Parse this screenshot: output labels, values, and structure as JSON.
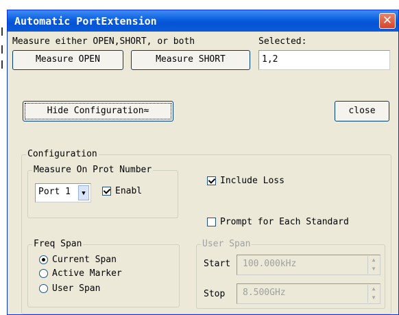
{
  "window": {
    "title": "Automatic PortExtension",
    "close_glyph": "✕"
  },
  "measure": {
    "instruction": "Measure either OPEN,SHORT, or both",
    "open_label": "Measure OPEN",
    "short_label": "Measure SHORT"
  },
  "selected": {
    "label": "Selected:",
    "value": "1,2"
  },
  "toggle_config_label": "Hide Configuration≈",
  "close_label": "close",
  "configuration": {
    "title": "Configuration",
    "port_group": {
      "title": "Measure On Prot Number",
      "port_value": "Port 1",
      "enable_label": "Enabl",
      "enable_checked": true
    },
    "include_loss": {
      "label": "Include Loss",
      "checked": true
    },
    "prompt_each": {
      "label": "Prompt for Each Standard",
      "checked": false
    },
    "freq_span": {
      "title": "Freq Span",
      "options": [
        "Current Span",
        "Active Marker",
        "User Span"
      ],
      "selected": "Current Span"
    },
    "user_span": {
      "title": "User Span",
      "start_label": "Start",
      "start_value": "100.000kHz",
      "stop_label": "Stop",
      "stop_value": "8.500GHz"
    }
  }
}
